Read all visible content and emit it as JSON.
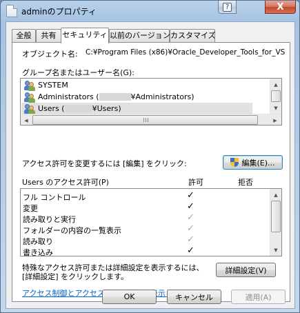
{
  "window": {
    "title": "adminのプロパティ",
    "help_glyph": "?",
    "close_glyph": "X"
  },
  "tabs": [
    {
      "label": "全般",
      "active": false
    },
    {
      "label": "共有",
      "active": false
    },
    {
      "label": "セキュリティ",
      "active": true
    },
    {
      "label": "以前のバージョン",
      "active": false
    },
    {
      "label": "カスタマイズ",
      "active": false
    }
  ],
  "object_name": {
    "label": "オブジェクト名:",
    "value": "C:¥Program Files (x86)¥Oracle_Developer_Tools_for_VS"
  },
  "groups": {
    "label": "グループ名またはユーザー名(G):",
    "items": [
      {
        "name": "SYSTEM"
      },
      {
        "name": "Administrators (",
        "suffix": "¥Administrators)"
      },
      {
        "name": "Users (",
        "suffix": "¥Users)"
      }
    ]
  },
  "change_prompt": "アクセス許可を変更するには [編集] をクリック:",
  "edit_button": "編集(E)...",
  "permissions": {
    "title": "Users のアクセス許可(P)",
    "allow_header": "許可",
    "deny_header": "拒否",
    "rows": [
      {
        "name": "フル コントロール",
        "allow": "✓",
        "inherited": false
      },
      {
        "name": "変更",
        "allow": "✓",
        "inherited": false
      },
      {
        "name": "読み取りと実行",
        "allow": "✓",
        "inherited": true
      },
      {
        "name": "フォルダーの内容の一覧表示",
        "allow": "✓",
        "inherited": true
      },
      {
        "name": "読み取り",
        "allow": "✓",
        "inherited": true
      },
      {
        "name": "書き込み",
        "allow": "✓",
        "inherited": false
      }
    ]
  },
  "advanced": {
    "text_line1": "特殊なアクセス許可または詳細設定を表示するには、",
    "text_line2": "[詳細設定] をクリックします。",
    "button": "詳細設定(V)"
  },
  "learn_link": "アクセス制御とアクセス許可の詳細を表示します。",
  "footer": {
    "ok": "OK",
    "cancel": "キャンセル",
    "apply": "適用(A)"
  },
  "colors": {
    "link": "#0066cc",
    "close_button": "#c2472e",
    "focus_border": "#3c7fb1"
  }
}
